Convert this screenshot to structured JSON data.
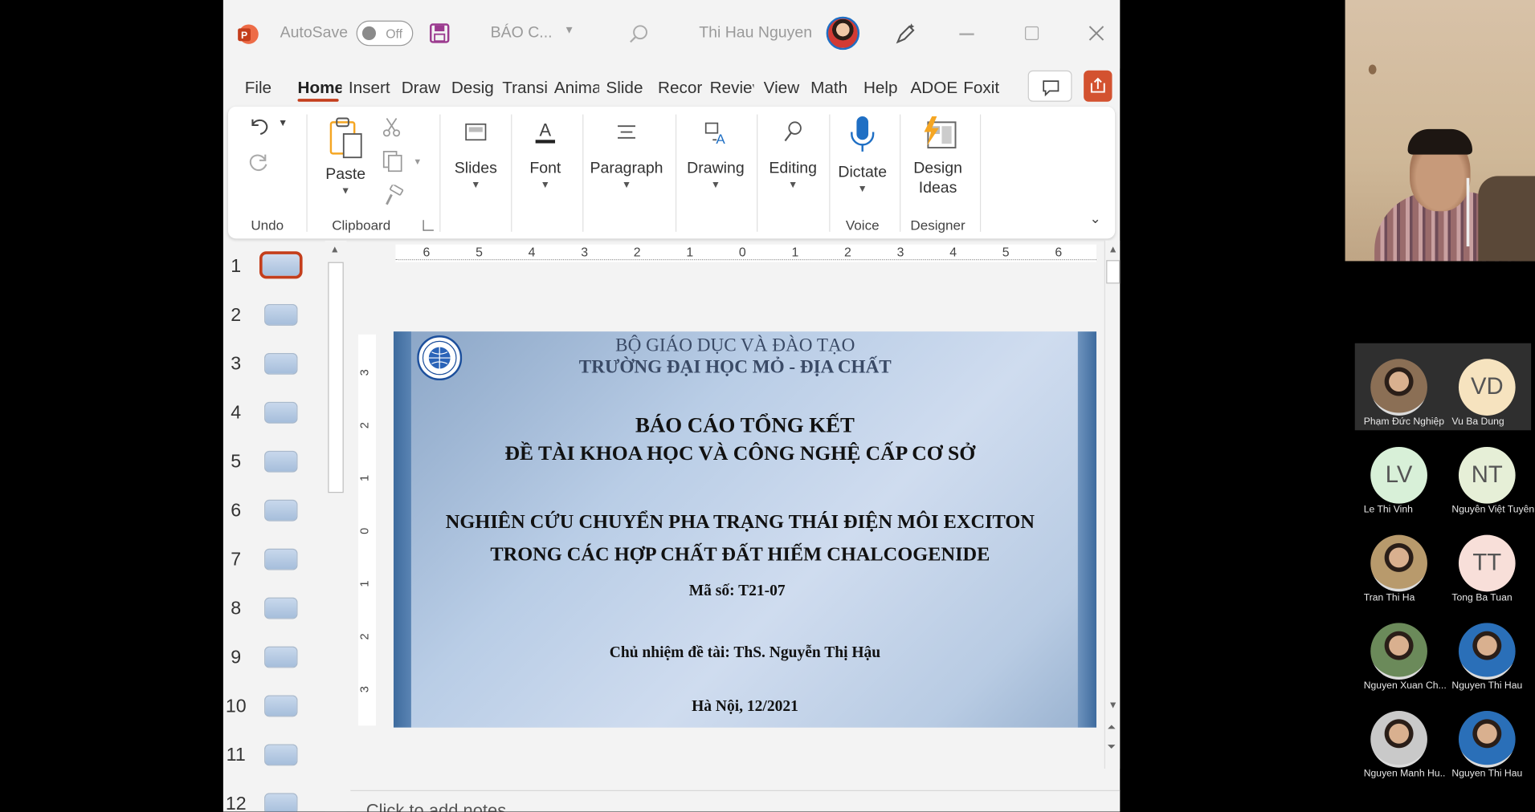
{
  "titlebar": {
    "autosave_label": "AutoSave",
    "autosave_state": "Off",
    "file_name": "BÁO C...",
    "user_name": "Thi Hau Nguyen"
  },
  "tabs": [
    "File",
    "Home",
    "Insert",
    "Draw",
    "Desig",
    "Transi",
    "Anima",
    "Slide",
    "Recor",
    "Reviev",
    "View",
    "Math",
    "Help",
    "ADOE",
    "Foxit"
  ],
  "ribbon": {
    "undo_group": "Undo",
    "paste": "Paste",
    "clipboard_group": "Clipboard",
    "slides": "Slides",
    "font": "Font",
    "paragraph": "Paragraph",
    "drawing": "Drawing",
    "editing": "Editing",
    "dictate": "Dictate",
    "voice_group": "Voice",
    "design_ideas_1": "Design",
    "design_ideas_2": "Ideas",
    "designer_group": "Designer"
  },
  "ruler_ticks": [
    "6",
    "5",
    "4",
    "3",
    "2",
    "1",
    "0",
    "1",
    "2",
    "3",
    "4",
    "5",
    "6"
  ],
  "vruler_ticks": [
    "3",
    "2",
    "1",
    "0",
    "1",
    "2",
    "3"
  ],
  "slide_numbers": [
    "1",
    "2",
    "3",
    "4",
    "5",
    "6",
    "7",
    "8",
    "9",
    "10",
    "11",
    "12"
  ],
  "slide": {
    "ministry": "BỘ GIÁO DỤC VÀ ĐÀO TẠO",
    "university": "TRƯỜNG ĐẠI HỌC MỎ - ĐỊA CHẤT",
    "report_line1": "BÁO CÁO TỔNG KẾT",
    "report_line2": "ĐỀ TÀI KHOA HỌC VÀ CÔNG NGHỆ CẤP CƠ SỞ",
    "topic_line1": "NGHIÊN CỨU CHUYỂN PHA TRẠNG THÁI ĐIỆN MÔI EXCITON",
    "topic_line2": "TRONG CÁC HỢP CHẤT ĐẤT HIẾM CHALCOGENIDE",
    "code": "Mã số: T21-07",
    "leader": "Chủ nhiệm đề tài: ThS. Nguyễn Thị Hậu",
    "place_date": "Hà Nội, 12/2021"
  },
  "notes_placeholder": "Click to add notes",
  "participants": [
    {
      "name": "Phạm Đức Nghiệp",
      "initials": "",
      "color": "#8b6f55"
    },
    {
      "name": "Vu Ba Dung",
      "initials": "VD",
      "color": "#f6e3bf"
    },
    {
      "name": "Le Thi Vinh",
      "initials": "LV",
      "color": "#d8f0d8"
    },
    {
      "name": "Nguyễn Việt Tuyên",
      "initials": "NT",
      "color": "#e6efd7"
    },
    {
      "name": "Tran Thi Ha",
      "initials": "",
      "color": "#b89a6c"
    },
    {
      "name": "Tong Ba Tuan",
      "initials": "TT",
      "color": "#f8dfd9"
    },
    {
      "name": "Nguyen Xuan Ch...",
      "initials": "",
      "color": "#6b8a5a"
    },
    {
      "name": "Nguyen Thi Hau",
      "initials": "",
      "color": "#2a6fb8"
    },
    {
      "name": "Nguyen Manh Hu...",
      "initials": "",
      "color": "#c9c9c9"
    },
    {
      "name": "Nguyen Thi Hau",
      "initials": "",
      "color": "#2a6fb8"
    }
  ]
}
